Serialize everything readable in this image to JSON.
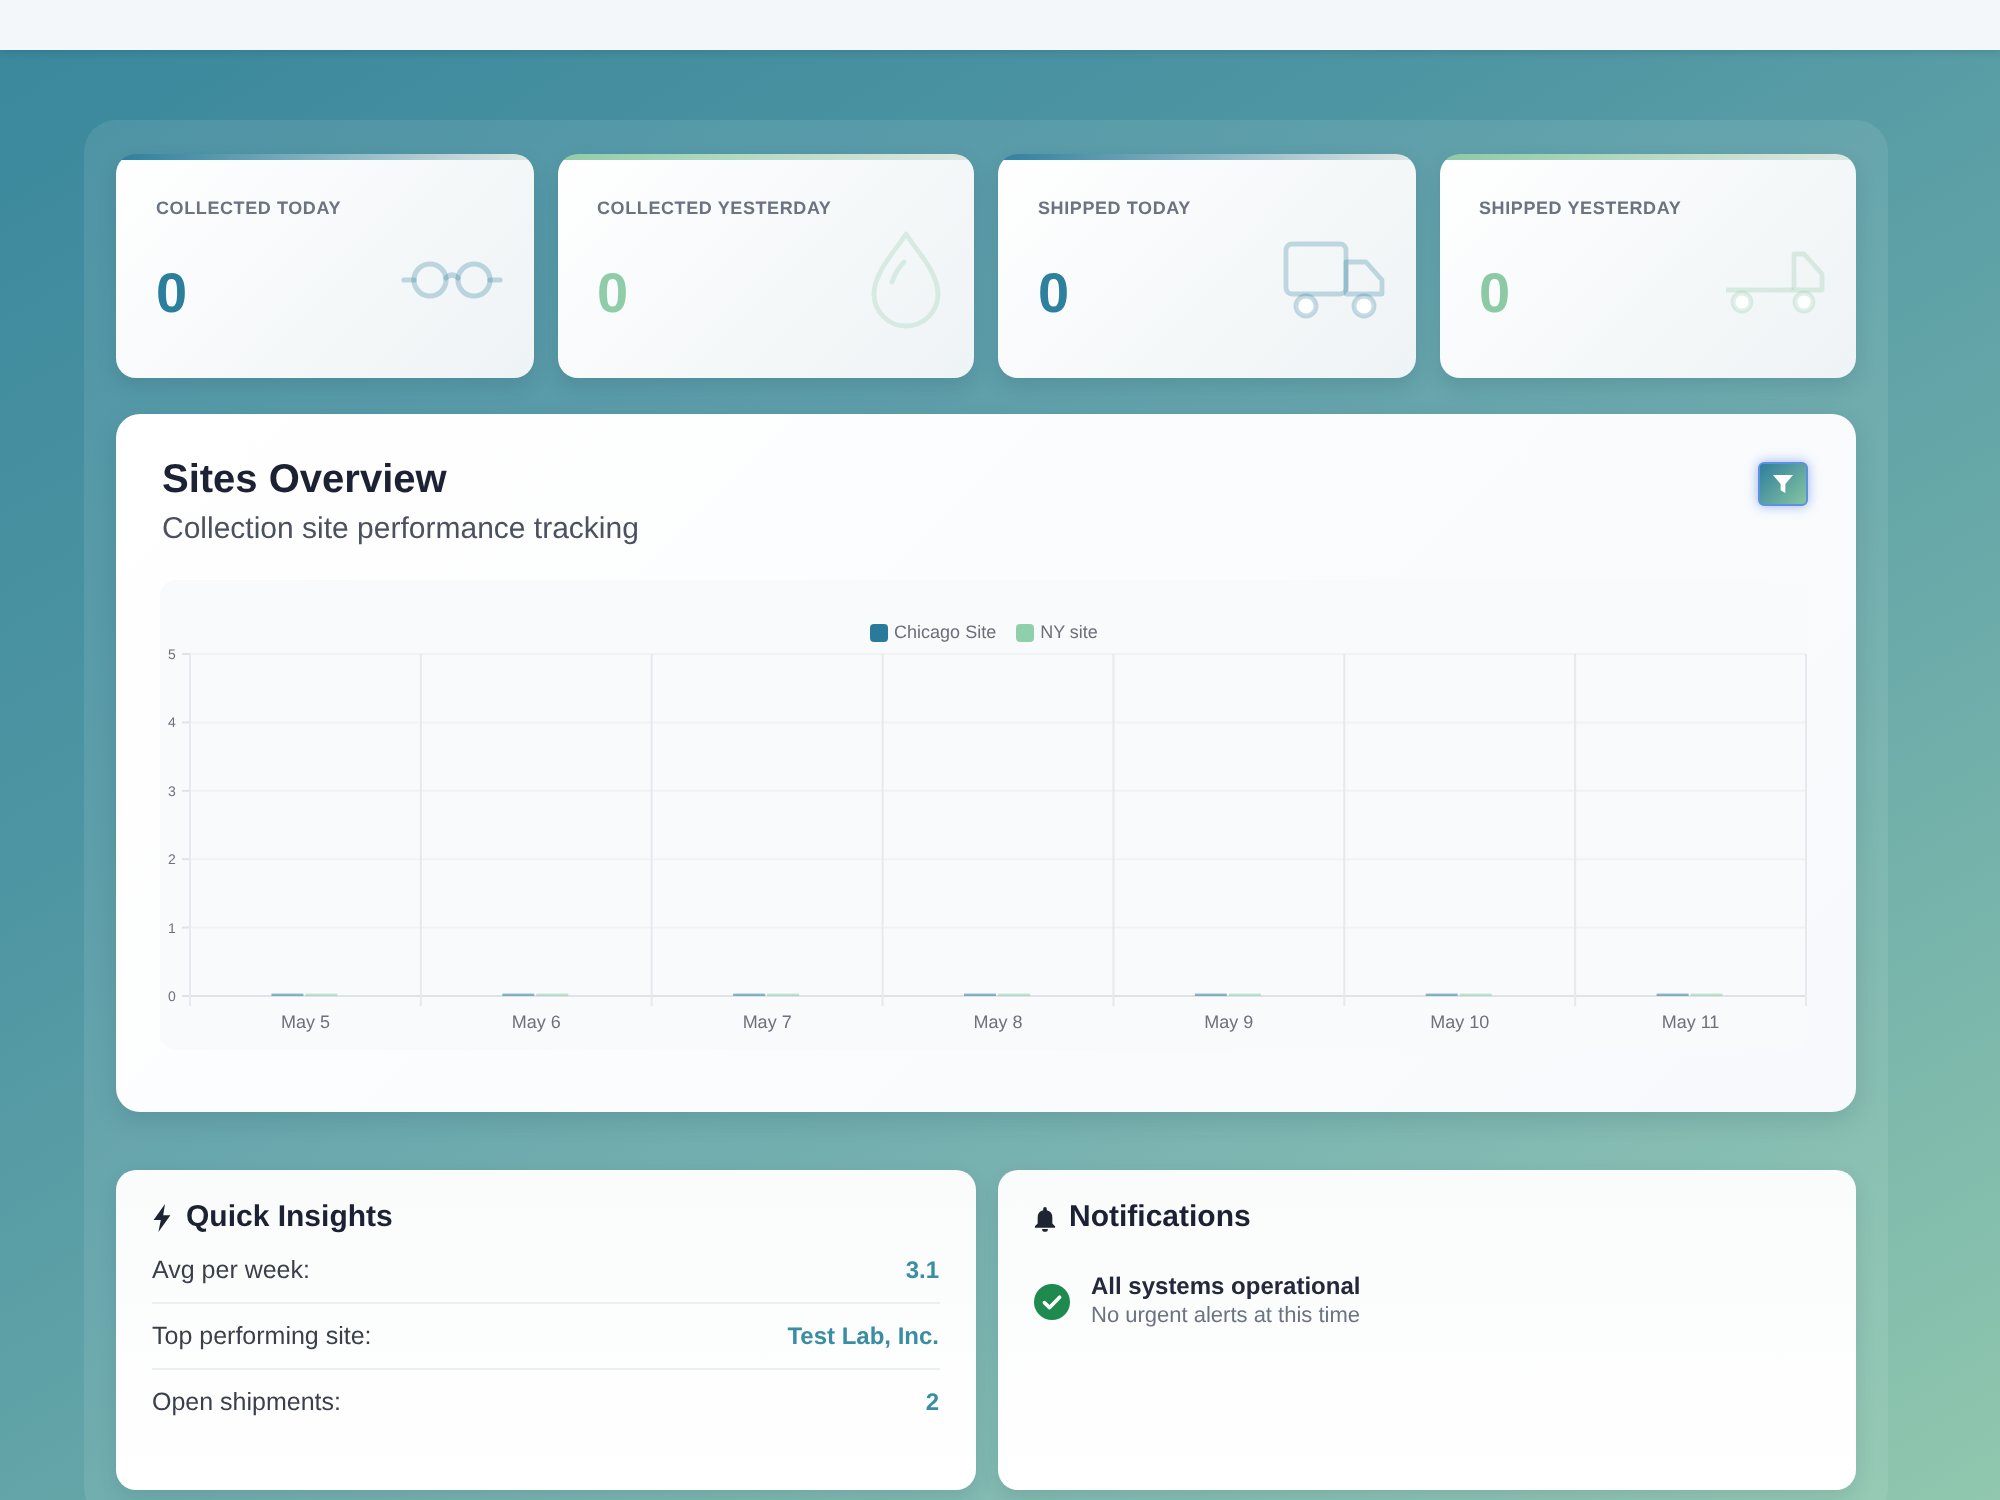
{
  "stats": [
    {
      "label": "COLLECTED TODAY",
      "value": "0",
      "color": "#2b7f9d"
    },
    {
      "label": "COLLECTED YESTERDAY",
      "value": "0",
      "color": "#8fcda8"
    },
    {
      "label": "SHIPPED TODAY",
      "value": "0",
      "color": "#2e809f"
    },
    {
      "label": "SHIPPED YESTERDAY",
      "value": "0",
      "color": "#8ccaa6"
    }
  ],
  "sites_overview": {
    "title": "Sites Overview",
    "subtitle": "Collection site performance tracking",
    "chart_data": {
      "type": "bar",
      "categories": [
        "May 5",
        "May 6",
        "May 7",
        "May 8",
        "May 9",
        "May 10",
        "May 11"
      ],
      "series": [
        {
          "name": "Chicago Site",
          "color": "#2a7b9b",
          "values": [
            0,
            0,
            0,
            0,
            0,
            0,
            0
          ]
        },
        {
          "name": "NY site",
          "color": "#8fcfa9",
          "values": [
            0,
            0,
            0,
            0,
            0,
            0,
            0
          ]
        }
      ],
      "ylim": [
        0,
        5
      ],
      "yticks": [
        0,
        1,
        2,
        3,
        4,
        5
      ],
      "grid": true,
      "legend": true
    }
  },
  "quick_insights": {
    "title": "Quick Insights",
    "rows": [
      {
        "label": "Avg per week:",
        "value": "3.1"
      },
      {
        "label": "Top performing site:",
        "value": "Test Lab, Inc."
      },
      {
        "label": "Open shipments:",
        "value": "2"
      }
    ]
  },
  "notifications": {
    "title": "Notifications",
    "items": [
      {
        "kind": "success",
        "title": "All systems operational",
        "detail": "No urgent alerts at this time"
      }
    ]
  }
}
